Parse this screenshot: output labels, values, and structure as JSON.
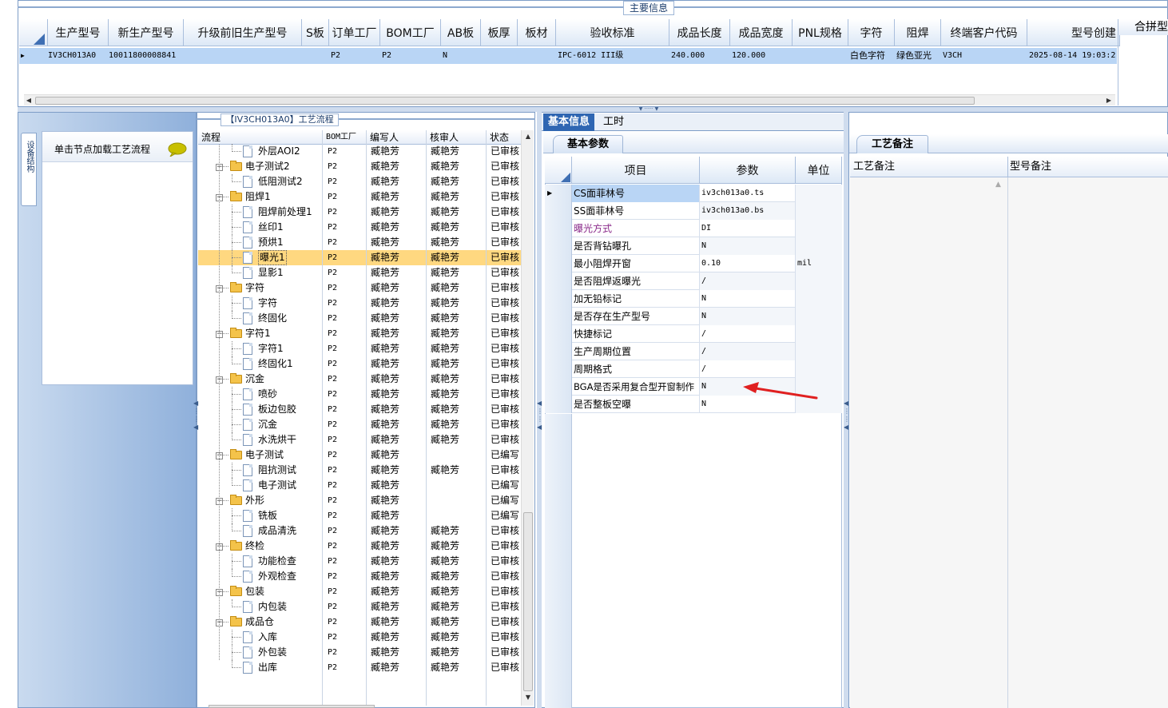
{
  "main_info": {
    "group_title": "主要信息",
    "columns": [
      "生产型号",
      "新生产型号",
      "升级前旧生产型号",
      "S板",
      "订单工厂",
      "BOM工厂",
      "AB板",
      "板厚",
      "板材",
      "验收标准",
      "成品长度",
      "成品宽度",
      "PNL规格",
      "字符",
      "阻焊",
      "终端客户代码",
      "型号创建"
    ],
    "right_column": "合拼型",
    "row": {
      "model": "IV3CH013A0",
      "new_model": "10011800008841",
      "order_factory": "P2",
      "bom_factory": "P2",
      "ab_board": "N",
      "standard": "IPC-6012 III级",
      "length": "240.000",
      "width": "120.000",
      "char": "白色字符",
      "solder": "绿色亚光",
      "customer": "V3CH",
      "created": "2025-08-14 19:03:2"
    }
  },
  "left_panel": {
    "vertical_tab": "设备结构",
    "hint": "单击节点加载工艺流程"
  },
  "flow": {
    "title": "【IV3CH013A0】工艺流程",
    "columns": [
      "流程",
      "BOM工厂",
      "编写人",
      "核审人",
      "状态"
    ],
    "rows": [
      {
        "name": "外层AOI2",
        "level": 2,
        "bom": "P2",
        "writer": "臧艳芳",
        "reviewer": "臧艳芳",
        "status": "已审核"
      },
      {
        "name": "电子测试2",
        "level": 1,
        "bom": "P2",
        "writer": "臧艳芳",
        "reviewer": "臧艳芳",
        "status": "已审核"
      },
      {
        "name": "低阻测试2",
        "level": 2,
        "bom": "P2",
        "writer": "臧艳芳",
        "reviewer": "臧艳芳",
        "status": "已审核"
      },
      {
        "name": "阻焊1",
        "level": 1,
        "bom": "P2",
        "writer": "臧艳芳",
        "reviewer": "臧艳芳",
        "status": "已审核"
      },
      {
        "name": "阻焊前处理1",
        "level": 2,
        "bom": "P2",
        "writer": "臧艳芳",
        "reviewer": "臧艳芳",
        "status": "已审核"
      },
      {
        "name": "丝印1",
        "level": 2,
        "bom": "P2",
        "writer": "臧艳芳",
        "reviewer": "臧艳芳",
        "status": "已审核"
      },
      {
        "name": "预烘1",
        "level": 2,
        "bom": "P2",
        "writer": "臧艳芳",
        "reviewer": "臧艳芳",
        "status": "已审核"
      },
      {
        "name": "曝光1",
        "level": 2,
        "bom": "P2",
        "writer": "臧艳芳",
        "reviewer": "臧艳芳",
        "status": "已审核",
        "selected": true
      },
      {
        "name": "显影1",
        "level": 2,
        "bom": "P2",
        "writer": "臧艳芳",
        "reviewer": "臧艳芳",
        "status": "已审核"
      },
      {
        "name": "字符",
        "level": 1,
        "bom": "P2",
        "writer": "臧艳芳",
        "reviewer": "臧艳芳",
        "status": "已审核"
      },
      {
        "name": "字符",
        "level": 2,
        "bom": "P2",
        "writer": "臧艳芳",
        "reviewer": "臧艳芳",
        "status": "已审核"
      },
      {
        "name": "终固化",
        "level": 2,
        "bom": "P2",
        "writer": "臧艳芳",
        "reviewer": "臧艳芳",
        "status": "已审核"
      },
      {
        "name": "字符1",
        "level": 1,
        "bom": "P2",
        "writer": "臧艳芳",
        "reviewer": "臧艳芳",
        "status": "已审核"
      },
      {
        "name": "字符1",
        "level": 2,
        "bom": "P2",
        "writer": "臧艳芳",
        "reviewer": "臧艳芳",
        "status": "已审核"
      },
      {
        "name": "终固化1",
        "level": 2,
        "bom": "P2",
        "writer": "臧艳芳",
        "reviewer": "臧艳芳",
        "status": "已审核"
      },
      {
        "name": "沉金",
        "level": 1,
        "bom": "P2",
        "writer": "臧艳芳",
        "reviewer": "臧艳芳",
        "status": "已审核"
      },
      {
        "name": "喷砂",
        "level": 2,
        "bom": "P2",
        "writer": "臧艳芳",
        "reviewer": "臧艳芳",
        "status": "已审核"
      },
      {
        "name": "板边包胶",
        "level": 2,
        "bom": "P2",
        "writer": "臧艳芳",
        "reviewer": "臧艳芳",
        "status": "已审核"
      },
      {
        "name": "沉金",
        "level": 2,
        "bom": "P2",
        "writer": "臧艳芳",
        "reviewer": "臧艳芳",
        "status": "已审核"
      },
      {
        "name": "水洗烘干",
        "level": 2,
        "bom": "P2",
        "writer": "臧艳芳",
        "reviewer": "臧艳芳",
        "status": "已审核"
      },
      {
        "name": "电子测试",
        "level": 1,
        "bom": "P2",
        "writer": "臧艳芳",
        "reviewer": "",
        "status": "已编写"
      },
      {
        "name": "阻抗测试",
        "level": 2,
        "bom": "P2",
        "writer": "臧艳芳",
        "reviewer": "臧艳芳",
        "status": "已审核"
      },
      {
        "name": "电子测试",
        "level": 2,
        "bom": "P2",
        "writer": "臧艳芳",
        "reviewer": "",
        "status": "已编写"
      },
      {
        "name": "外形",
        "level": 1,
        "bom": "P2",
        "writer": "臧艳芳",
        "reviewer": "",
        "status": "已编写"
      },
      {
        "name": "铣板",
        "level": 2,
        "bom": "P2",
        "writer": "臧艳芳",
        "reviewer": "",
        "status": "已编写"
      },
      {
        "name": "成品清洗",
        "level": 2,
        "bom": "P2",
        "writer": "臧艳芳",
        "reviewer": "臧艳芳",
        "status": "已审核"
      },
      {
        "name": "终检",
        "level": 1,
        "bom": "P2",
        "writer": "臧艳芳",
        "reviewer": "臧艳芳",
        "status": "已审核"
      },
      {
        "name": "功能检查",
        "level": 2,
        "bom": "P2",
        "writer": "臧艳芳",
        "reviewer": "臧艳芳",
        "status": "已审核"
      },
      {
        "name": "外观检查",
        "level": 2,
        "bom": "P2",
        "writer": "臧艳芳",
        "reviewer": "臧艳芳",
        "status": "已审核"
      },
      {
        "name": "包装",
        "level": 1,
        "bom": "P2",
        "writer": "臧艳芳",
        "reviewer": "臧艳芳",
        "status": "已审核"
      },
      {
        "name": "内包装",
        "level": 2,
        "bom": "P2",
        "writer": "臧艳芳",
        "reviewer": "臧艳芳",
        "status": "已审核"
      },
      {
        "name": "成品仓",
        "level": 1,
        "bom": "P2",
        "writer": "臧艳芳",
        "reviewer": "臧艳芳",
        "status": "已审核"
      },
      {
        "name": "入库",
        "level": 2,
        "bom": "P2",
        "writer": "臧艳芳",
        "reviewer": "臧艳芳",
        "status": "已审核"
      },
      {
        "name": "外包装",
        "level": 2,
        "bom": "P2",
        "writer": "臧艳芳",
        "reviewer": "臧艳芳",
        "status": "已审核"
      },
      {
        "name": "出库",
        "level": 2,
        "bom": "P2",
        "writer": "臧艳芳",
        "reviewer": "臧艳芳",
        "status": "已审核"
      }
    ]
  },
  "detail": {
    "tabs": [
      "基本信息",
      "工时"
    ],
    "subtab": "基本参数",
    "columns": [
      "项目",
      "参数",
      "单位"
    ],
    "params": [
      {
        "item": "CS面菲林号",
        "value": "iv3ch013a0.ts",
        "unit": ""
      },
      {
        "item": "SS面菲林号",
        "value": "iv3ch013a0.bs",
        "unit": ""
      },
      {
        "item": "曝光方式",
        "value": "DI",
        "unit": "",
        "accent": "#8a2a8a"
      },
      {
        "item": "是否背钻曝孔",
        "value": "N",
        "unit": ""
      },
      {
        "item": "最小阻焊开窗",
        "value": "0.10",
        "unit": "mil"
      },
      {
        "item": "是否阻焊返曝光",
        "value": "/",
        "unit": ""
      },
      {
        "item": "加无铅标记",
        "value": "N",
        "unit": ""
      },
      {
        "item": "是否存在生产型号",
        "value": "N",
        "unit": ""
      },
      {
        "item": "快捷标记",
        "value": "/",
        "unit": ""
      },
      {
        "item": "生产周期位置",
        "value": "/",
        "unit": ""
      },
      {
        "item": "周期格式",
        "value": "/",
        "unit": ""
      },
      {
        "item": "BGA是否采用复合型开窗制作",
        "value": "N",
        "unit": ""
      },
      {
        "item": "是否整板空曝",
        "value": "N",
        "unit": ""
      }
    ]
  },
  "notes": {
    "tab": "工艺备注",
    "columns": [
      "工艺备注",
      "型号备注"
    ]
  },
  "colors": {
    "accent_blue": "#2f66b2",
    "selected_row": "#ffd880",
    "annotation_arrow": "#e02020"
  }
}
